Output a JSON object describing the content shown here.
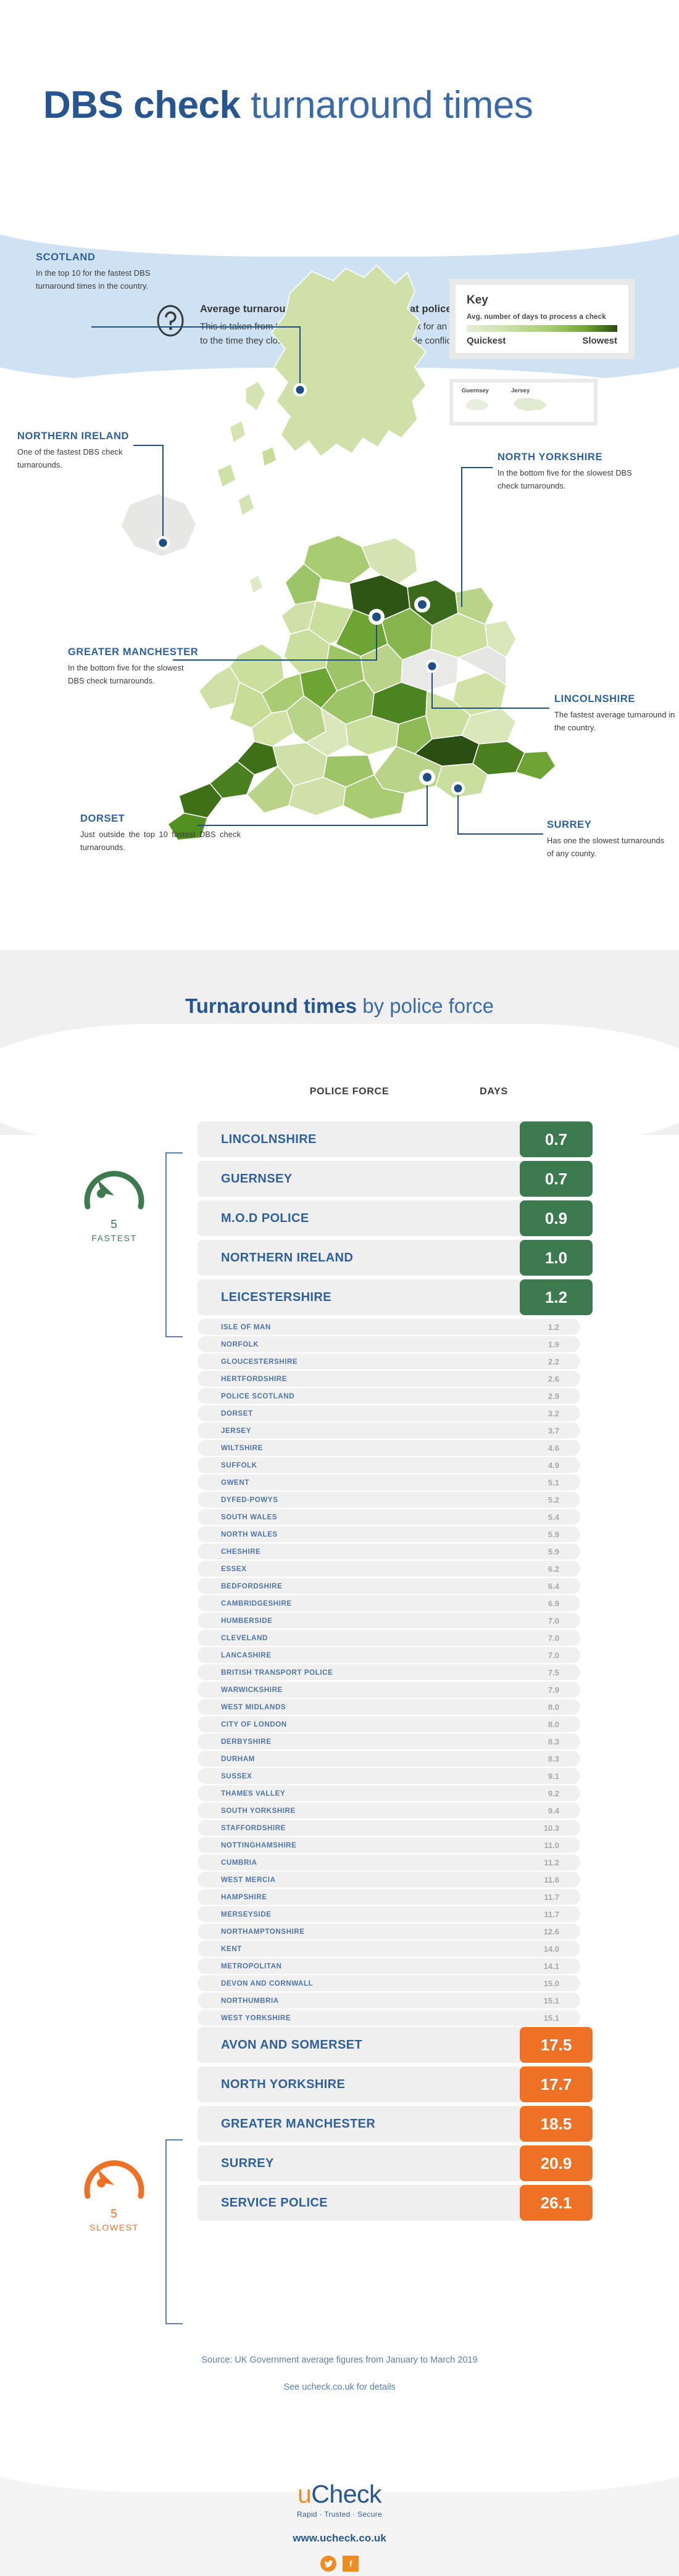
{
  "header": {
    "title_bold": "DBS check",
    "title_light": " turnaround times",
    "intro_title": "Average turnaround times for DBS checks at police forces",
    "intro_line1": "This is taken from the first time a force is sent a check for an applicant",
    "intro_line2": "to the time they close that check (this does not include conflict time).",
    "question_icon": "question-mark-icon"
  },
  "map": {
    "key": {
      "title": "Key",
      "subtitle": "Avg. number of days to process a check",
      "low_label": "Quickest",
      "high_label": "Slowest",
      "gradient_low": "#e6eed8",
      "gradient_high": "#2c4a10"
    },
    "islands": [
      {
        "name": "Guernsey"
      },
      {
        "name": "Jersey"
      }
    ],
    "callouts": [
      {
        "id": "scotland",
        "title": "SCOTLAND",
        "body": "In the top 10 for the fastest DBS turnaround times in the country."
      },
      {
        "id": "northern-ireland",
        "title": "NORTHERN IRELAND",
        "body": "One of the fastest DBS check turnarounds."
      },
      {
        "id": "north-yorkshire",
        "title": "NORTH YORKSHIRE",
        "body": "In the bottom five for the slowest DBS check turnarounds."
      },
      {
        "id": "greater-manchester",
        "title": "GREATER MANCHESTER",
        "body": "In the bottom five for the slowest DBS check turnarounds."
      },
      {
        "id": "lincolnshire",
        "title": "LINCOLNSHIRE",
        "body": "The fastest average turnaround in the country."
      },
      {
        "id": "dorset",
        "title": "DORSET",
        "body": "Just outside the top 10 fastest DBS check turnarounds."
      },
      {
        "id": "surrey",
        "title": "SURREY",
        "body": "Has one the slowest turnarounds of any county."
      }
    ]
  },
  "table": {
    "section_title_bold": "Turnaround times",
    "section_title_light": " by police force",
    "col_force": "POLICE FORCE",
    "col_days": "DAYS",
    "fastest_badge_number": "5",
    "fastest_badge_word": "FASTEST",
    "slowest_badge_number": "5",
    "slowest_badge_word": "SLOWEST",
    "fastest_color": "#3e7a50",
    "slowest_color": "#ef7126"
  },
  "footer": {
    "source": "Source: UK Government average figures from January to March 2019",
    "see_more": "See ucheck.co.uk for details",
    "logo_u": "u",
    "logo_rest": "Check",
    "logo_tagline": "Rapid · Trusted · Secure",
    "url": "www.ucheck.co.uk",
    "social": [
      {
        "name": "twitter-icon"
      },
      {
        "name": "facebook-icon"
      }
    ]
  },
  "chart_data": {
    "type": "bar",
    "title": "Turnaround times by police force",
    "xlabel": "POLICE FORCE",
    "ylabel": "DAYS",
    "unit": "days",
    "source": "UK Government average figures from January to March 2019",
    "categories": [
      "LINCOLNSHIRE",
      "GUERNSEY",
      "M.O.D POLICE",
      "NORTHERN IRELAND",
      "LEICESTERSHIRE",
      "ISLE OF MAN",
      "NORFOLK",
      "GLOUCESTERSHIRE",
      "HERTFORDSHIRE",
      "POLICE SCOTLAND",
      "DORSET",
      "JERSEY",
      "WILTSHIRE",
      "SUFFOLK",
      "GWENT",
      "DYFED-POWYS",
      "SOUTH WALES",
      "NORTH WALES",
      "CHESHIRE",
      "ESSEX",
      "BEDFORDSHIRE",
      "CAMBRIDGESHIRE",
      "HUMBERSIDE",
      "CLEVELAND",
      "LANCASHIRE",
      "BRITISH TRANSPORT POLICE",
      "WARWICKSHIRE",
      "WEST MIDLANDS",
      "CITY OF LONDON",
      "DERBYSHIRE",
      "DURHAM",
      "SUSSEX",
      "THAMES VALLEY",
      "SOUTH YORKSHIRE",
      "STAFFORDSHIRE",
      "NOTTINGHAMSHIRE",
      "CUMBRIA",
      "WEST MERCIA",
      "HAMPSHIRE",
      "MERSEYSIDE",
      "NORTHAMPTONSHIRE",
      "KENT",
      "METROPOLITAN",
      "DEVON AND CORNWALL",
      "NORTHUMBRIA",
      "WEST YORKSHIRE",
      "AVON AND SOMERSET",
      "NORTH YORKSHIRE",
      "GREATER MANCHESTER",
      "SURREY",
      "SERVICE POLICE"
    ],
    "values": [
      0.7,
      0.7,
      0.9,
      1.0,
      1.2,
      1.2,
      1.9,
      2.2,
      2.6,
      2.9,
      3.2,
      3.7,
      4.6,
      4.9,
      5.1,
      5.2,
      5.4,
      5.9,
      5.9,
      6.2,
      6.4,
      6.9,
      7.0,
      7.0,
      7.0,
      7.5,
      7.9,
      8.0,
      8.0,
      8.3,
      8.3,
      9.1,
      9.2,
      9.4,
      10.3,
      11.0,
      11.2,
      11.6,
      11.7,
      11.7,
      12.6,
      14.0,
      14.1,
      15.0,
      15.1,
      15.1,
      17.5,
      17.7,
      18.5,
      20.9,
      26.1
    ],
    "groups": {
      "fastest_5": [
        {
          "force": "LINCOLNSHIRE",
          "days": "0.7"
        },
        {
          "force": "GUERNSEY",
          "days": "0.7"
        },
        {
          "force": "M.O.D POLICE",
          "days": "0.9"
        },
        {
          "force": "NORTHERN IRELAND",
          "days": "1.0"
        },
        {
          "force": "LEICESTERSHIRE",
          "days": "1.2"
        }
      ],
      "middle": [
        {
          "force": "ISLE OF MAN",
          "days": "1.2"
        },
        {
          "force": "NORFOLK",
          "days": "1.9"
        },
        {
          "force": "GLOUCESTERSHIRE",
          "days": "2.2"
        },
        {
          "force": "HERTFORDSHIRE",
          "days": "2.6"
        },
        {
          "force": "POLICE SCOTLAND",
          "days": "2.9"
        },
        {
          "force": "DORSET",
          "days": "3.2"
        },
        {
          "force": "JERSEY",
          "days": "3.7"
        },
        {
          "force": "WILTSHIRE",
          "days": "4.6"
        },
        {
          "force": "SUFFOLK",
          "days": "4.9"
        },
        {
          "force": "GWENT",
          "days": "5.1"
        },
        {
          "force": "DYFED-POWYS",
          "days": "5.2"
        },
        {
          "force": "SOUTH WALES",
          "days": "5.4"
        },
        {
          "force": "NORTH WALES",
          "days": "5.9"
        },
        {
          "force": "CHESHIRE",
          "days": "5.9"
        },
        {
          "force": "ESSEX",
          "days": "6.2"
        },
        {
          "force": "BEDFORDSHIRE",
          "days": "6.4"
        },
        {
          "force": "CAMBRIDGESHIRE",
          "days": "6.9"
        },
        {
          "force": "HUMBERSIDE",
          "days": "7.0"
        },
        {
          "force": "CLEVELAND",
          "days": "7.0"
        },
        {
          "force": "LANCASHIRE",
          "days": "7.0"
        },
        {
          "force": "BRITISH TRANSPORT POLICE",
          "days": "7.5"
        },
        {
          "force": "WARWICKSHIRE",
          "days": "7.9"
        },
        {
          "force": "WEST MIDLANDS",
          "days": "8.0"
        },
        {
          "force": "CITY OF LONDON",
          "days": "8.0"
        },
        {
          "force": "DERBYSHIRE",
          "days": "8.3"
        },
        {
          "force": "DURHAM",
          "days": "8.3"
        },
        {
          "force": "SUSSEX",
          "days": "9.1"
        },
        {
          "force": "THAMES VALLEY",
          "days": "9.2"
        },
        {
          "force": "SOUTH YORKSHIRE",
          "days": "9.4"
        },
        {
          "force": "STAFFORDSHIRE",
          "days": "10.3"
        },
        {
          "force": "NOTTINGHAMSHIRE",
          "days": "11.0"
        },
        {
          "force": "CUMBRIA",
          "days": "11.2"
        },
        {
          "force": "WEST MERCIA",
          "days": "11.6"
        },
        {
          "force": "HAMPSHIRE",
          "days": "11.7"
        },
        {
          "force": "MERSEYSIDE",
          "days": "11.7"
        },
        {
          "force": "NORTHAMPTONSHIRE",
          "days": "12.6"
        },
        {
          "force": "KENT",
          "days": "14.0"
        },
        {
          "force": "METROPOLITAN",
          "days": "14.1"
        },
        {
          "force": "DEVON AND CORNWALL",
          "days": "15.0"
        },
        {
          "force": "NORTHUMBRIA",
          "days": "15.1"
        },
        {
          "force": "WEST YORKSHIRE",
          "days": "15.1"
        }
      ],
      "slowest_5": [
        {
          "force": "AVON AND SOMERSET",
          "days": "17.5"
        },
        {
          "force": "NORTH YORKSHIRE",
          "days": "17.7"
        },
        {
          "force": "GREATER MANCHESTER",
          "days": "18.5"
        },
        {
          "force": "SURREY",
          "days": "20.9"
        },
        {
          "force": "SERVICE POLICE",
          "days": "26.1"
        }
      ]
    }
  }
}
